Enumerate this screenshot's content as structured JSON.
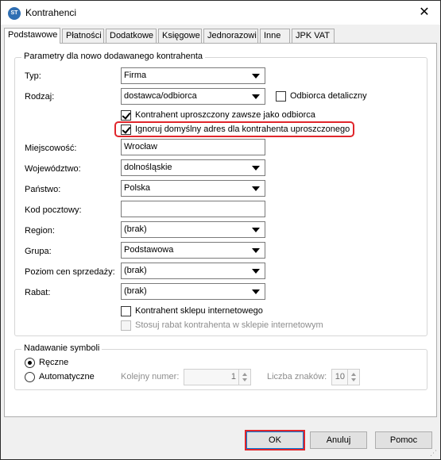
{
  "window": {
    "title": "Kontrahenci",
    "app_icon_text": "ST"
  },
  "tabs": [
    {
      "label": "Podstawowe",
      "active": true
    },
    {
      "label": "Płatności"
    },
    {
      "label": "Dodatkowe"
    },
    {
      "label": "Księgowe"
    },
    {
      "label": "Jednorazowi"
    },
    {
      "label": "Inne"
    },
    {
      "label": "JPK VAT"
    }
  ],
  "params": {
    "legend": "Parametry dla nowo dodawanego kontrahenta",
    "typ": {
      "label": "Typ:",
      "value": "Firma"
    },
    "rodzaj": {
      "label": "Rodzaj:",
      "value": "dostawca/odbiorca"
    },
    "odbiorca_detaliczny": {
      "label": "Odbiorca detaliczny",
      "checked": false
    },
    "uproszczony_odbiorca": {
      "label": "Kontrahent uproszczony zawsze jako odbiorca",
      "checked": true
    },
    "ignoruj_adres": {
      "label": "Ignoruj domyślny adres dla kontrahenta uproszczonego",
      "checked": true
    },
    "miejscowosc": {
      "label": "Miejscowość:",
      "value": "Wrocław"
    },
    "wojewodztwo": {
      "label": "Województwo:",
      "value": "dolnośląskie"
    },
    "panstwo": {
      "label": "Państwo:",
      "value": "Polska"
    },
    "kod_pocztowy": {
      "label": "Kod pocztowy:",
      "value": ""
    },
    "region": {
      "label": "Region:",
      "value": "(brak)"
    },
    "grupa": {
      "label": "Grupa:",
      "value": "Podstawowa"
    },
    "poziom_cen": {
      "label": "Poziom cen sprzedaży:",
      "value": "(brak)"
    },
    "rabat": {
      "label": "Rabat:",
      "value": "(brak)"
    },
    "sklep_internetowy": {
      "label": "Kontrahent sklepu internetowego",
      "checked": false
    },
    "stosuj_rabat": {
      "label": "Stosuj rabat kontrahenta w sklepie internetowym",
      "checked": false,
      "disabled": true
    }
  },
  "symbole": {
    "legend": "Nadawanie symboli",
    "reczne": {
      "label": "Ręczne",
      "selected": true
    },
    "automatyczne": {
      "label": "Automatyczne",
      "selected": false
    },
    "kolejny_numer": {
      "label": "Kolejny numer:",
      "value": "1"
    },
    "liczba_znakow": {
      "label": "Liczba znaków:",
      "value": "10"
    }
  },
  "buttons": {
    "ok": "OK",
    "cancel": "Anuluj",
    "help": "Pomoc"
  },
  "colors": {
    "highlight": "#e0252b",
    "default_button_border": "#0078d7"
  }
}
